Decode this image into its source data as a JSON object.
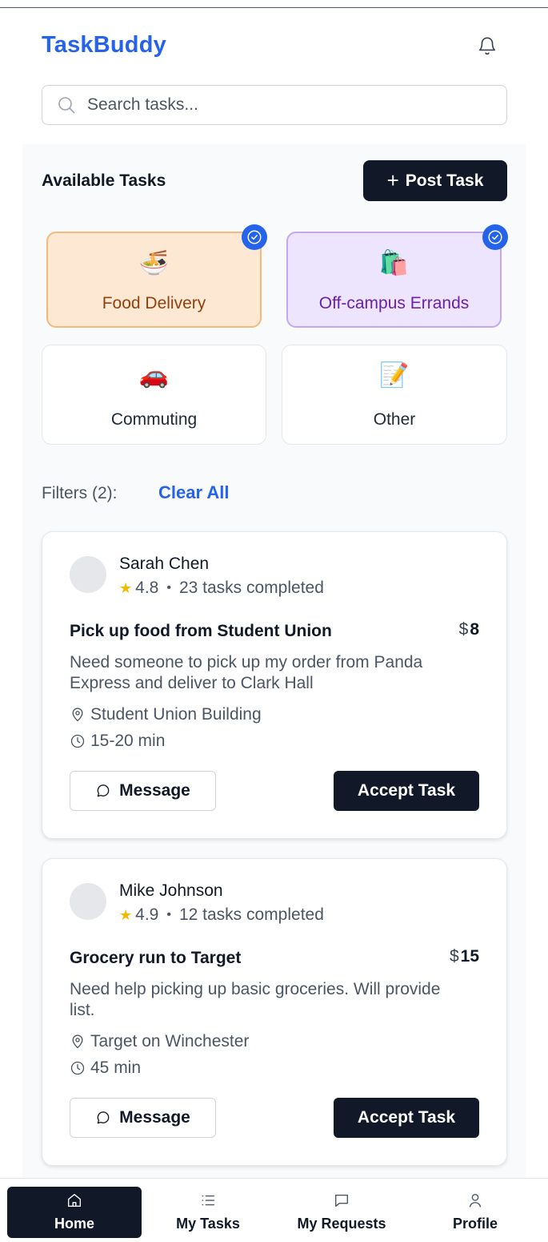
{
  "app": {
    "brand": "TaskBuddy",
    "accent_color": "#2563eb"
  },
  "header": {
    "bell_icon": "bell-icon"
  },
  "search": {
    "placeholder": "Search tasks...",
    "value": ""
  },
  "section": {
    "title": "Available Tasks",
    "post_button_label": "Post Task"
  },
  "categories": [
    {
      "label": "Food Delivery",
      "emoji": "🍜",
      "selected": true
    },
    {
      "label": "Off-campus Errands",
      "emoji": "🛍️",
      "selected": true
    },
    {
      "label": "Commuting",
      "emoji": "🚗",
      "selected": false
    },
    {
      "label": "Other",
      "emoji": "📝",
      "selected": false
    }
  ],
  "filters": {
    "label": "Filters (2):",
    "clear_label": "Clear All"
  },
  "tasks": [
    {
      "user": "Sarah Chen",
      "rating": "4.8",
      "completed": "23 tasks completed",
      "title": "Pick up food from Student Union",
      "currency": "$",
      "price": "8",
      "description": "Need someone to pick up my order from Panda Express and deliver to Clark Hall",
      "location": "Student Union Building",
      "duration": "15-20 min",
      "message_label": "Message",
      "accept_label": "Accept Task"
    },
    {
      "user": "Mike Johnson",
      "rating": "4.9",
      "completed": "12 tasks completed",
      "title": "Grocery run to Target",
      "currency": "$",
      "price": "15",
      "description": "Need help picking up basic groceries. Will provide list.",
      "location": "Target on Winchester",
      "duration": "45 min",
      "message_label": "Message",
      "accept_label": "Accept Task"
    }
  ],
  "nav": [
    {
      "label": "Home",
      "icon": "home-icon",
      "active": true
    },
    {
      "label": "My Tasks",
      "icon": "list-icon",
      "active": false
    },
    {
      "label": "My Requests",
      "icon": "message-square-icon",
      "active": false
    },
    {
      "label": "Profile",
      "icon": "user-icon",
      "active": false
    }
  ]
}
